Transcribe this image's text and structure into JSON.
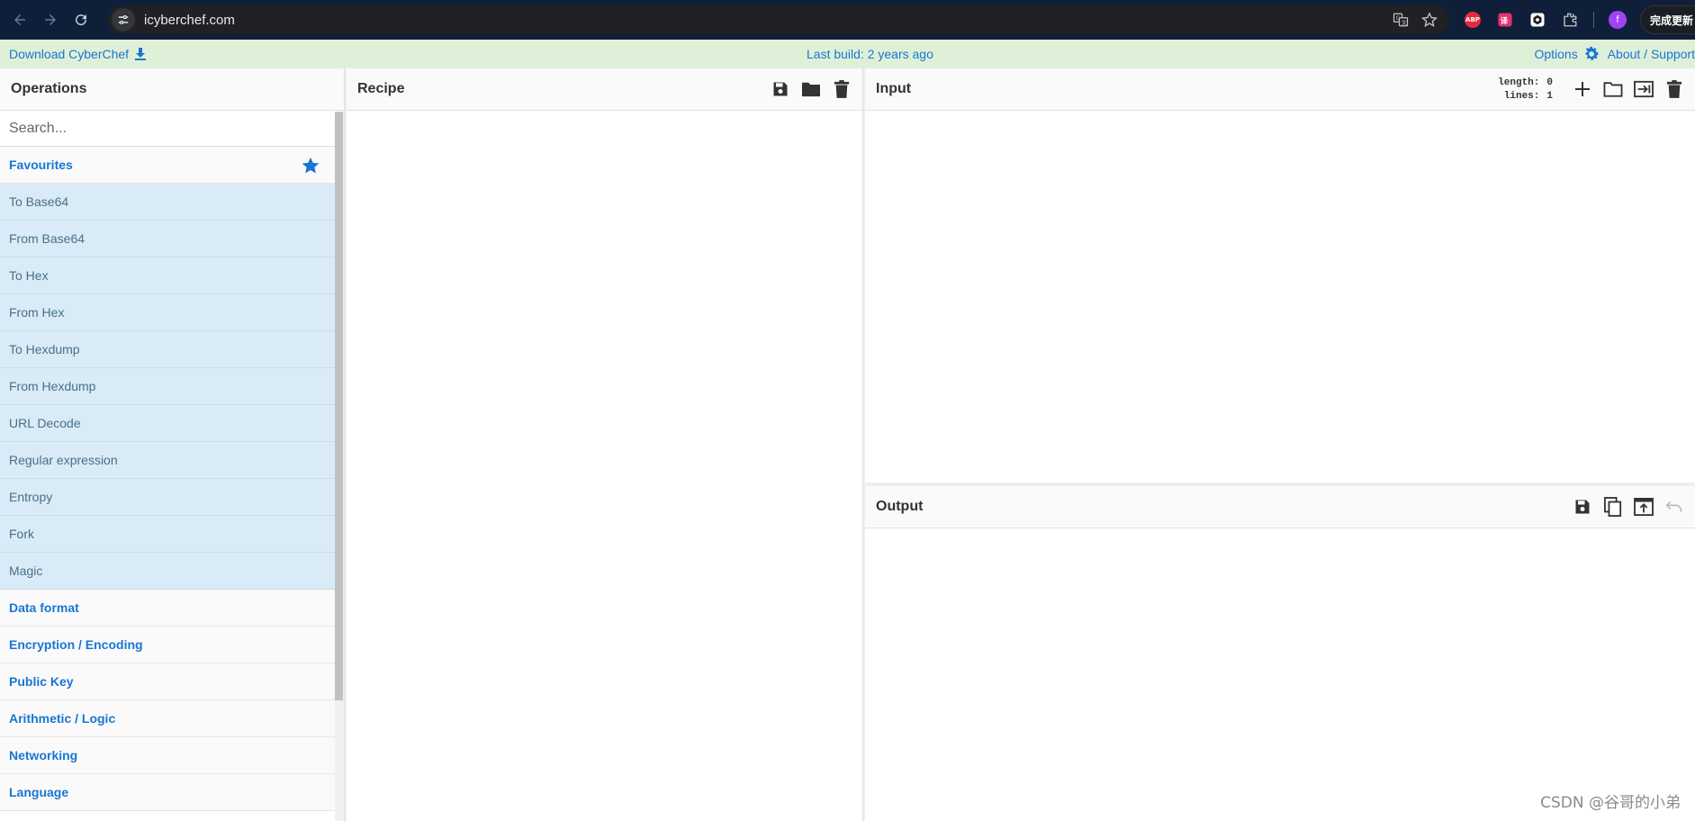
{
  "browser": {
    "url": "icyberchef.com",
    "update_label": "完成更新"
  },
  "banner": {
    "download_label": "Download CyberChef",
    "build_label": "Last build: 2 years ago",
    "options_label": "Options",
    "about_label": "About / Support"
  },
  "operations": {
    "title": "Operations",
    "search_placeholder": "Search...",
    "favourites_label": "Favourites",
    "favourites": [
      "To Base64",
      "From Base64",
      "To Hex",
      "From Hex",
      "To Hexdump",
      "From Hexdump",
      "URL Decode",
      "Regular expression",
      "Entropy",
      "Fork",
      "Magic"
    ],
    "categories": [
      "Data format",
      "Encryption / Encoding",
      "Public Key",
      "Arithmetic / Logic",
      "Networking",
      "Language"
    ]
  },
  "recipe": {
    "title": "Recipe"
  },
  "input": {
    "title": "Input",
    "length_label": "length:",
    "length_value": "0",
    "lines_label": "lines:",
    "lines_value": "1"
  },
  "output": {
    "title": "Output"
  },
  "watermark": "CSDN @谷哥的小弟",
  "colors": {
    "accent": "#1976d2",
    "banner_bg": "#dff0d8",
    "favourite_bg": "#d9ebf6",
    "browser_bar": "#0f1f3a"
  }
}
